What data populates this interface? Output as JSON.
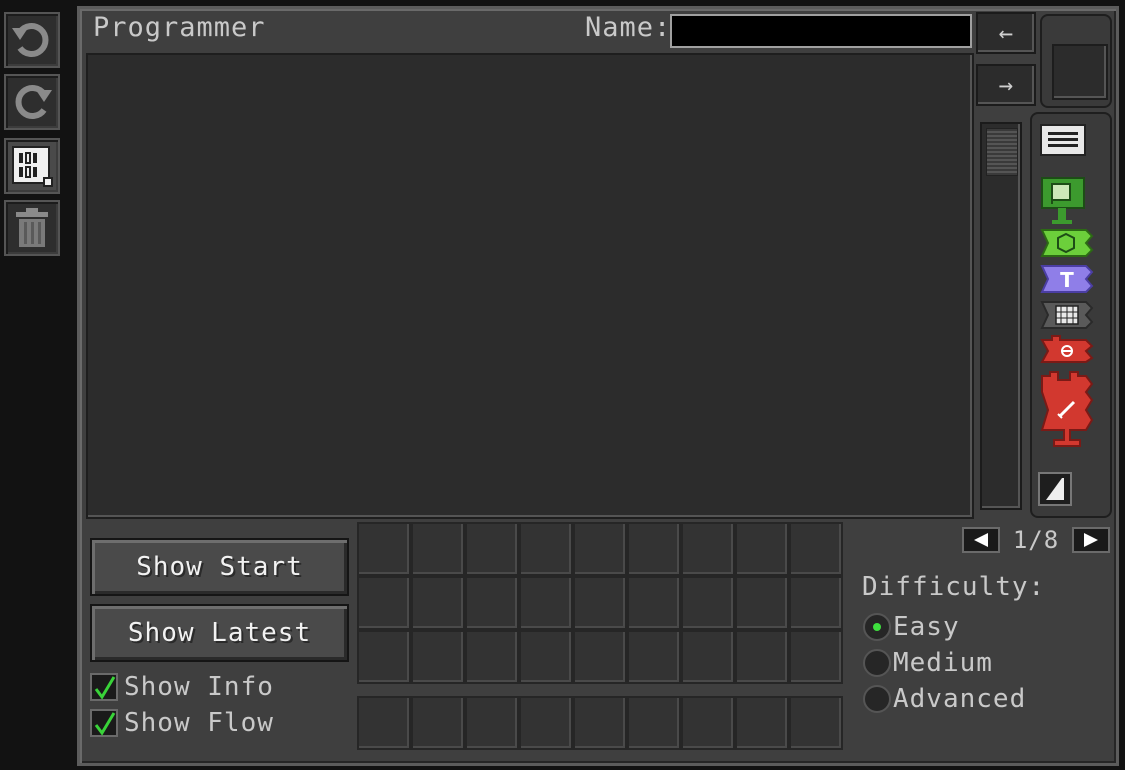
{
  "window": {
    "title": "Programmer"
  },
  "name_field": {
    "label": "Name:",
    "value": ""
  },
  "nav": {
    "back_arrow": "←",
    "forward_arrow": "→"
  },
  "toolbar": {
    "icons": [
      "undo-icon",
      "redo-icon",
      "program-card-icon",
      "trash-icon"
    ]
  },
  "palette": {
    "icons": [
      "menu-icon",
      "start-flag-widget-icon",
      "area-widget-icon",
      "text-widget-icon",
      "inventory-grid-widget-icon",
      "condition-widget-icon",
      "attack-widget-icon",
      "expand-corner-icon"
    ],
    "colors": {
      "green": "#3c9a2e",
      "lime": "#6ccf3b",
      "purple": "#8f7ee8",
      "gray": "#5a5a5a",
      "red": "#d2382f"
    }
  },
  "pager": {
    "text": "1/8"
  },
  "buttons": {
    "show_start": "Show Start",
    "show_latest": "Show Latest"
  },
  "checkboxes": [
    {
      "label": "Show Info",
      "checked": true
    },
    {
      "label": "Show Flow",
      "checked": true
    }
  ],
  "difficulty": {
    "label": "Difficulty:",
    "options": [
      "Easy",
      "Medium",
      "Advanced"
    ],
    "selected": "Easy"
  },
  "inventory": {
    "rows": 3,
    "cols": 9,
    "hotbar_cols": 9
  }
}
